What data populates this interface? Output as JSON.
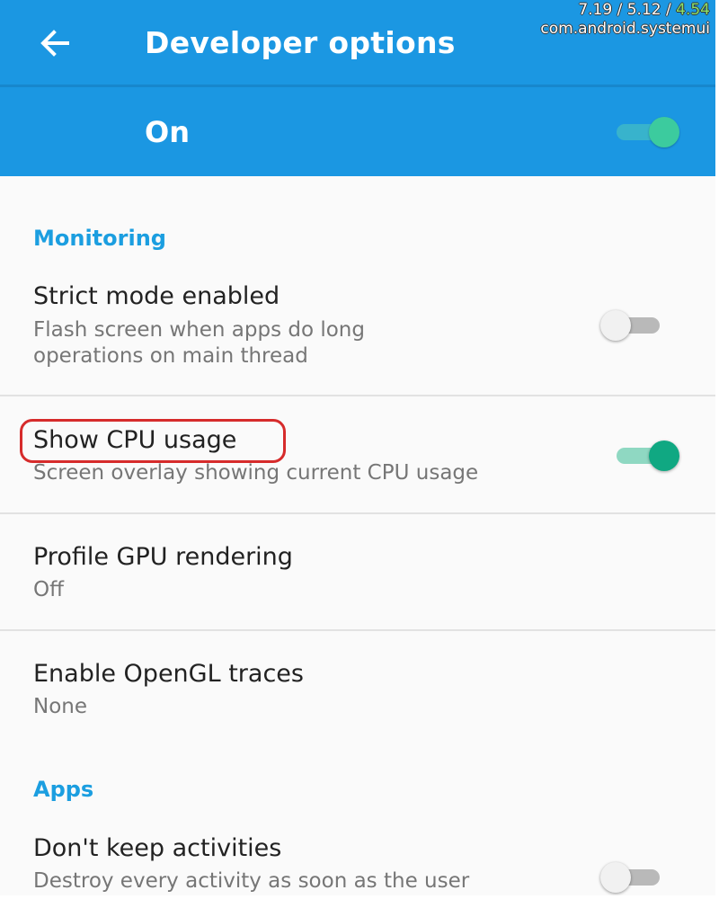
{
  "app_bar": {
    "title": "Developer options",
    "back_icon": "arrow-back-icon",
    "color": "#1b97e2"
  },
  "overlay": {
    "load_a": "7.19",
    "load_b": "5.12",
    "load_c": "4.54",
    "process": "com.android.systemui",
    "separator": " / "
  },
  "master_switch": {
    "label": "On",
    "state": "on"
  },
  "sections": {
    "monitoring": {
      "header": "Monitoring"
    },
    "apps": {
      "header": "Apps"
    }
  },
  "rows": {
    "strict_mode": {
      "title": "Strict mode enabled",
      "summary_line1": "Flash screen when apps do long",
      "summary_line2": "operations on main thread",
      "state": "off"
    },
    "show_cpu": {
      "title": "Show CPU usage",
      "summary": "Screen overlay showing current CPU usage",
      "state": "on"
    },
    "profile_gpu": {
      "title": "Profile GPU rendering",
      "summary": "Off"
    },
    "opengl_traces": {
      "title": "Enable OpenGL traces",
      "summary": "None"
    },
    "dont_keep": {
      "title": "Don't keep activities",
      "summary": "Destroy every activity as soon as the user",
      "state": "off"
    }
  },
  "colors": {
    "accent": "#1b9ee0",
    "switch_on": "#10a882",
    "highlight": "#d62b2b"
  }
}
